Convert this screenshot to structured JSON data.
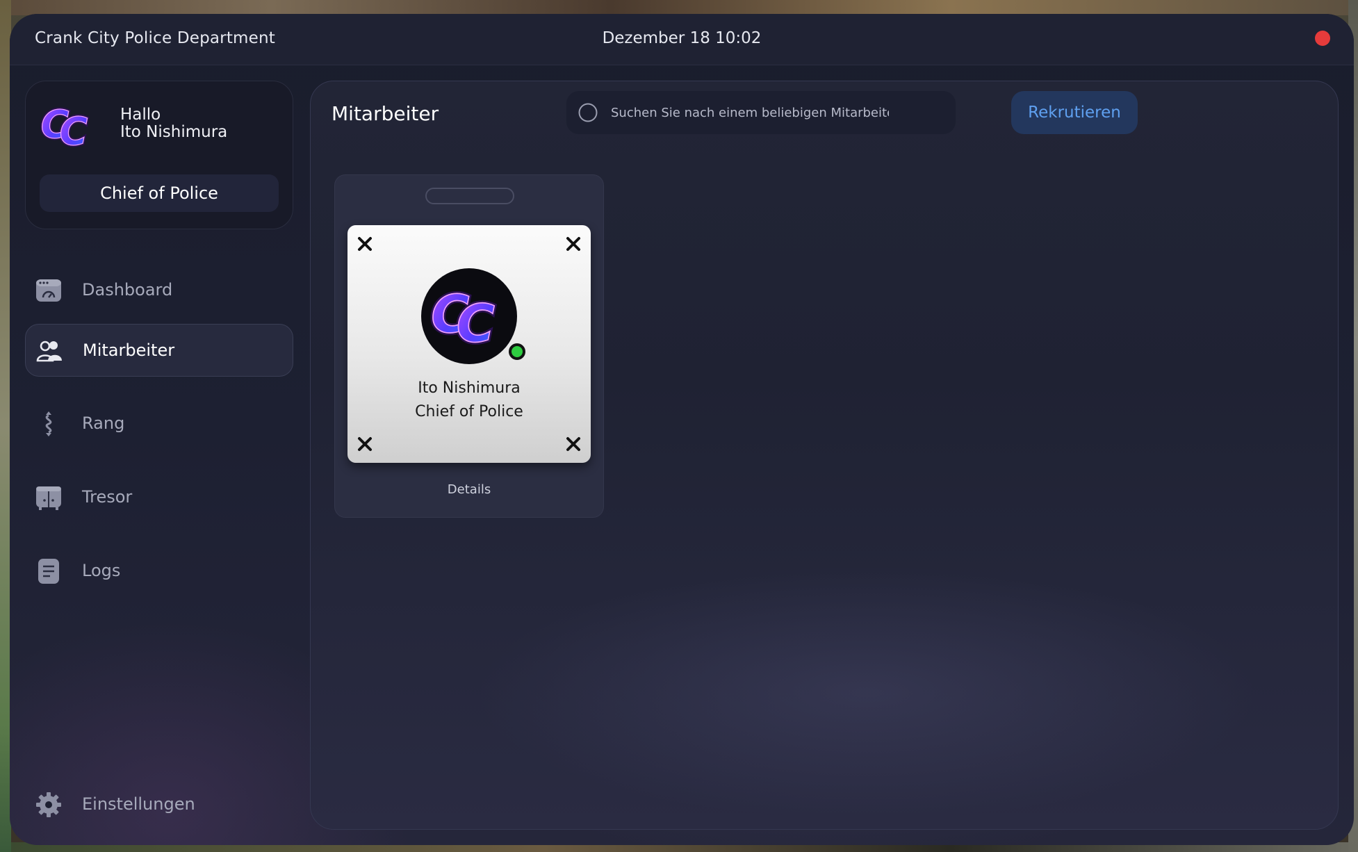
{
  "window": {
    "title": "Crank City Police Department",
    "datetime": "Dezember 18 10:02"
  },
  "profile": {
    "greeting": "Hallo",
    "name": "Ito Nishimura",
    "role": "Chief of Police"
  },
  "sidebar": {
    "items": [
      {
        "label": "Dashboard",
        "icon": "dashboard-icon",
        "active": false
      },
      {
        "label": "Mitarbeiter",
        "icon": "users-icon",
        "active": true
      },
      {
        "label": "Rang",
        "icon": "rank-icon",
        "active": false
      },
      {
        "label": "Tresor",
        "icon": "vault-icon",
        "active": false
      },
      {
        "label": "Logs",
        "icon": "logs-icon",
        "active": false
      }
    ],
    "settings_label": "Einstellungen"
  },
  "main": {
    "title": "Mitarbeiter",
    "search": {
      "placeholder": "Suchen Sie nach einem beliebigen Mitarbeiter",
      "value": ""
    },
    "recruit_label": "Rekrutieren",
    "employees": [
      {
        "name": "Ito Nishimura",
        "rank": "Chief of Police",
        "online": true,
        "details_label": "Details"
      }
    ]
  },
  "colors": {
    "accent": "#5fa0f0",
    "close": "#e53b3b",
    "online": "#2ecc40"
  }
}
